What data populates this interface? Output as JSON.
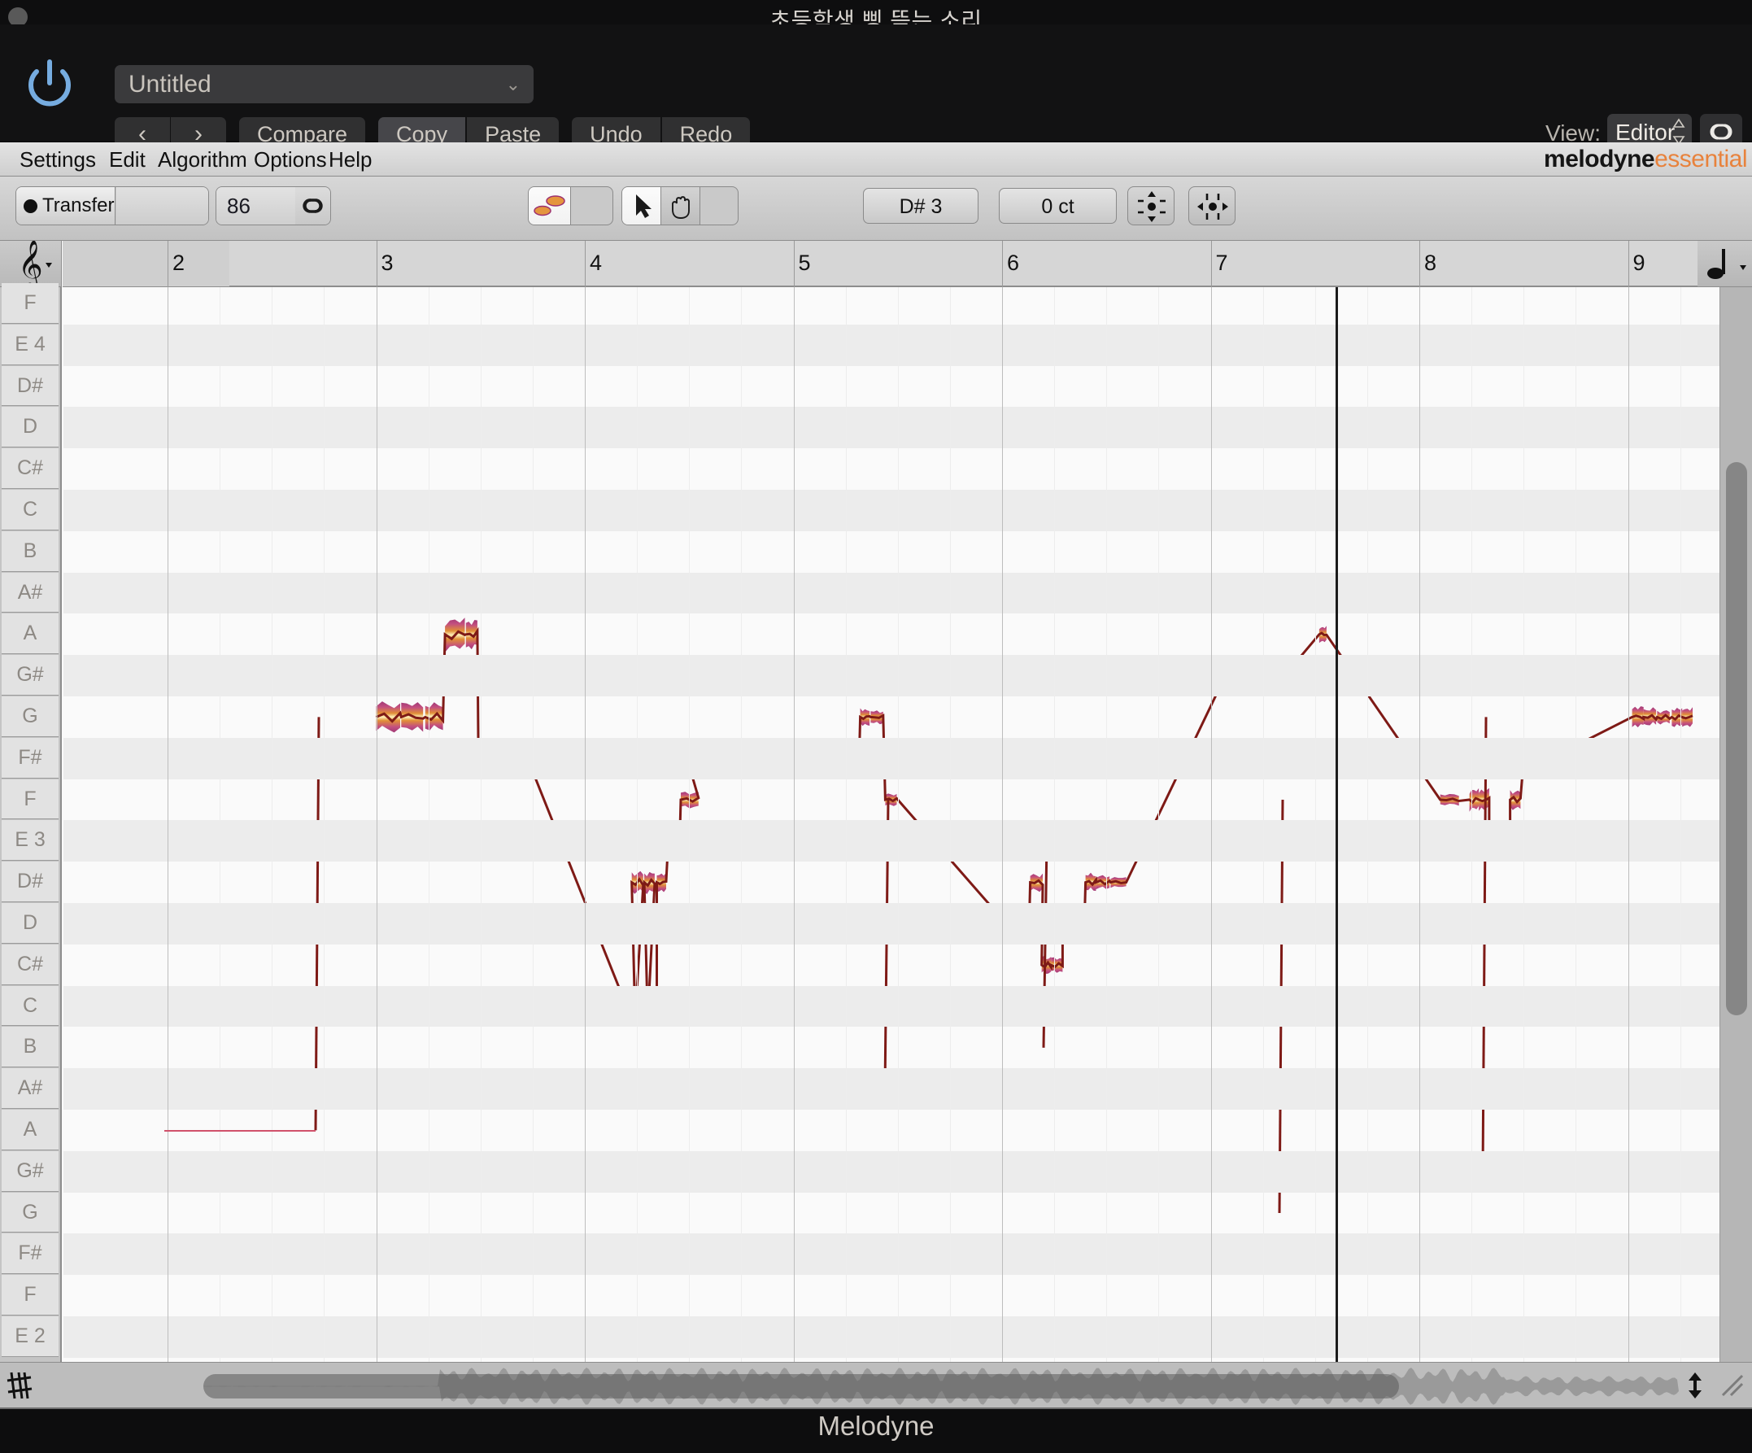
{
  "window": {
    "title": "초등학생 삥 뜯는 소리",
    "close_button": "close",
    "footer_app_name": "Melodyne"
  },
  "header": {
    "power_icon": "power-icon",
    "preset": {
      "value": "Untitled",
      "chevron": "⌄"
    },
    "nav_prev": "‹",
    "nav_next": "›",
    "buttons": {
      "compare": "Compare",
      "copy": "Copy",
      "paste": "Paste",
      "undo": "Undo",
      "redo": "Redo"
    },
    "view_label": "View:",
    "view_value": "Editor",
    "view_stepper": "⌃⌄",
    "link_icon": "link-icon"
  },
  "menubar": {
    "items": [
      "Settings",
      "Edit",
      "Algorithm",
      "Options",
      "Help"
    ],
    "brand_primary": "melodyne",
    "brand_secondary": "essential"
  },
  "toolbar": {
    "transfer_label": "Transfer",
    "transfer_record_icon": "record-dot-icon",
    "transfer_field_value": "",
    "tempo_value": "86",
    "tempo_link_icon": "link-icon",
    "tools_left": [
      {
        "name": "blob-edit-tool",
        "icon": "note-blobs-icon",
        "selected": true
      },
      {
        "name": "correct-pitch-tool",
        "icon": "wrench-icon",
        "selected": false
      }
    ],
    "tools_right": [
      {
        "name": "arrow-tool",
        "icon": "arrow-cursor-icon",
        "selected": true
      },
      {
        "name": "hand-tool",
        "icon": "hand-icon",
        "selected": false
      },
      {
        "name": "zoom-tool",
        "icon": "magnifier-icon",
        "selected": false
      }
    ],
    "pitch_readout": "D# 3",
    "cents_readout": "0 ct",
    "separate_note_icon": "move-vertical-icon",
    "move-horizontal_icon": "move-horizontal-icon"
  },
  "editor": {
    "clef_icon": "treble-clef-icon",
    "clef_chevron": "▾",
    "note_value_icon": "quarter-note-icon",
    "ruler_bars": [
      "2",
      "3",
      "4",
      "5",
      "6",
      "7",
      "8",
      "9"
    ],
    "key_labels": [
      "F",
      "E 4",
      "D#",
      "D",
      "C#",
      "C",
      "B",
      "A#",
      "A",
      "G#",
      "G",
      "F#",
      "F",
      "E 3",
      "D#",
      "D",
      "C#",
      "C",
      "B",
      "A#",
      "A",
      "G#",
      "G",
      "F#",
      "F",
      "E 2"
    ],
    "playhead_bar": "7",
    "colors": {
      "blob_core": "#fdf0b6",
      "blob_mid": "#e08a2e",
      "blob_edge": "#9d3070",
      "pitch_curve": "#7e1a16",
      "guide_line": "#d0516b",
      "accent": "#e8823c",
      "playhead": "#1b1b1b"
    }
  },
  "overview": {
    "sharp_icon": "double-sharp-icon",
    "scroll_thumb": "horizontal-scroll-thumb",
    "resize_icon": "resize-arrows-icon",
    "corner_icon": "grip-corner-icon"
  }
}
